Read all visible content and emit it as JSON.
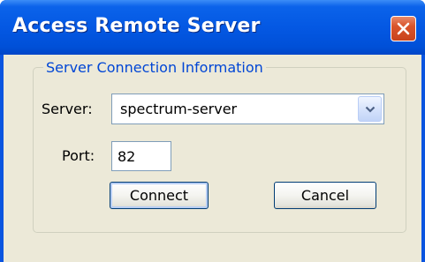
{
  "window": {
    "title": "Access Remote Server"
  },
  "group": {
    "title": "Server Connection Information"
  },
  "server": {
    "label": "Server:",
    "value": "spectrum-server"
  },
  "port": {
    "label": "Port:",
    "value": "82"
  },
  "buttons": {
    "connect": "Connect",
    "cancel": "Cancel"
  },
  "icons": {
    "close": "close-icon",
    "dropdown": "chevron-down-icon"
  },
  "colors": {
    "titlebar": "#0458e3",
    "close_button": "#d9542b",
    "dialog_body": "#ece9d8",
    "group_title": "#0046d5"
  }
}
